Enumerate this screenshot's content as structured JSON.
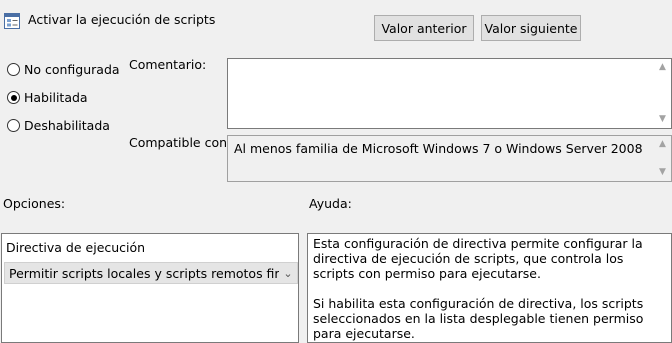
{
  "window": {
    "title": "Activar la ejecución de scripts",
    "icon": "policy-settings-icon"
  },
  "nav": {
    "prev_label": "Valor anterior",
    "next_label": "Valor siguiente"
  },
  "state": {
    "options": [
      {
        "label": "No configurada",
        "selected": false
      },
      {
        "label": "Habilitada",
        "selected": true
      },
      {
        "label": "Deshabilitada",
        "selected": false
      }
    ]
  },
  "comment": {
    "label": "Comentario:",
    "value": ""
  },
  "compatible": {
    "label": "Compatible con:",
    "value": "Al menos familia de Microsoft Windows 7 o Windows Server 2008"
  },
  "options_section": {
    "heading": "Opciones:",
    "policy_label": "Directiva de ejecución",
    "selected_value": "Permitir scripts locales y scripts remotos firmados"
  },
  "help_section": {
    "heading": "Ayuda:",
    "paragraphs": [
      "Esta configuración de directiva permite configurar la directiva de ejecución de scripts, que controla los scripts con permiso para ejecutarse.",
      "Si habilita esta configuración de directiva, los scripts seleccionados en la lista desplegable tienen permiso para ejecutarse."
    ]
  },
  "colors": {
    "window_bg": "#f0f0f0",
    "button_bg": "#e1e1e1",
    "dropdown_bg": "#e5e5e5"
  }
}
